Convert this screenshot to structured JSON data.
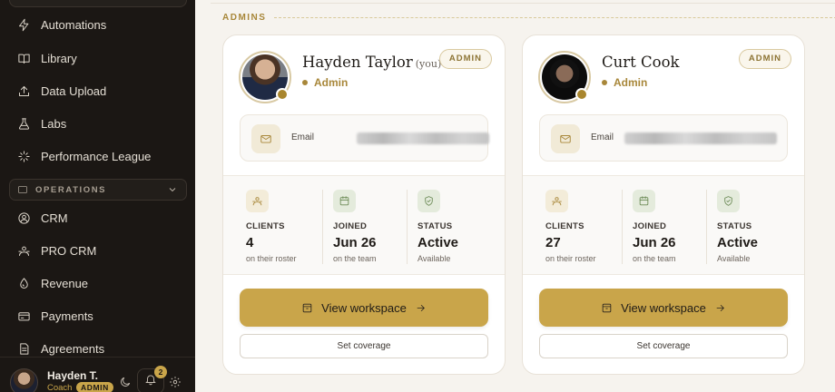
{
  "sidebar": {
    "items": [
      {
        "label": "Automations",
        "icon": "zap-icon"
      },
      {
        "label": "Library",
        "icon": "book-icon"
      },
      {
        "label": "Data Upload",
        "icon": "upload-icon"
      },
      {
        "label": "Labs",
        "icon": "flask-icon"
      },
      {
        "label": "Performance League",
        "icon": "sparkle-icon"
      }
    ],
    "section_label": "OPERATIONS",
    "ops_items": [
      {
        "label": "CRM",
        "icon": "user-circle-icon"
      },
      {
        "label": "PRO CRM",
        "icon": "users-icon"
      },
      {
        "label": "Revenue",
        "icon": "drop-icon"
      },
      {
        "label": "Payments",
        "icon": "card-icon"
      },
      {
        "label": "Agreements",
        "icon": "document-icon"
      }
    ],
    "user": {
      "name": "Hayden T.",
      "role": "Coach",
      "badge": "ADMIN",
      "notifications": "2"
    }
  },
  "main": {
    "section_title": "ADMINS",
    "cards": [
      {
        "name": "Hayden Taylor",
        "you": "(you)",
        "role": "Admin",
        "pill": "ADMIN",
        "email_label": "Email",
        "stats": [
          {
            "key": "CLIENTS",
            "value": "4",
            "sub": "on their roster"
          },
          {
            "key": "JOINED",
            "value": "Jun 26",
            "sub": "on the team"
          },
          {
            "key": "STATUS",
            "value": "Active",
            "sub": "Available"
          }
        ],
        "workspace_label": "View workspace",
        "coverage_label": "Set coverage"
      },
      {
        "name": "Curt Cook",
        "you": "",
        "role": "Admin",
        "pill": "ADMIN",
        "email_label": "Email",
        "stats": [
          {
            "key": "CLIENTS",
            "value": "27",
            "sub": "on their roster"
          },
          {
            "key": "JOINED",
            "value": "Jun 26",
            "sub": "on the team"
          },
          {
            "key": "STATUS",
            "value": "Active",
            "sub": "Available"
          }
        ],
        "workspace_label": "View workspace",
        "coverage_label": "Set coverage"
      }
    ]
  },
  "colors": {
    "sidebar_bg": "#1b1714",
    "accent": "#c9a54a",
    "accent_text": "#a8873a",
    "page_bg": "#f6f3ee"
  }
}
